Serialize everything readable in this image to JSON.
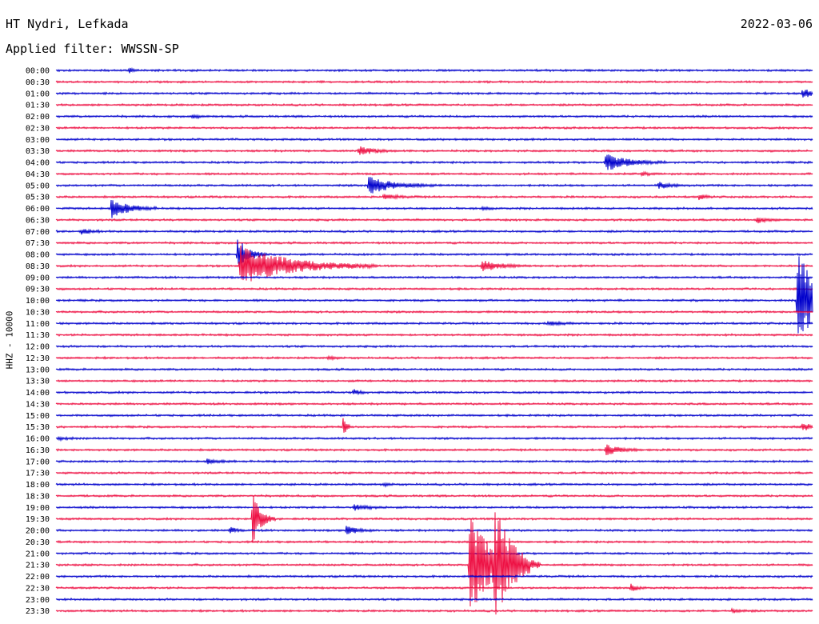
{
  "header": {
    "station": "HT Nydri, Lefkada",
    "date": "2022-03-06",
    "filter": "Applied filter: WWSSN-SP"
  },
  "chart_data": {
    "type": "line",
    "title": "HT Nydri, Lefkada",
    "subtitle": "Applied filter: WWSSN-SP",
    "ylabel": "HHZ - 10000",
    "rows": [
      "00:00",
      "00:30",
      "01:00",
      "01:30",
      "02:00",
      "02:30",
      "03:00",
      "03:30",
      "04:00",
      "04:30",
      "05:00",
      "05:30",
      "06:00",
      "06:30",
      "07:00",
      "07:30",
      "08:00",
      "08:30",
      "09:00",
      "09:30",
      "10:00",
      "10:30",
      "11:00",
      "11:30",
      "12:00",
      "12:30",
      "13:00",
      "13:30",
      "14:00",
      "14:30",
      "15:00",
      "15:30",
      "16:00",
      "16:30",
      "17:00",
      "17:30",
      "18:00",
      "18:30",
      "19:00",
      "19:30",
      "20:00",
      "20:30",
      "21:00",
      "21:30",
      "22:00",
      "22:30",
      "23:00",
      "23:30"
    ],
    "row_colors": [
      "#0000cc",
      "#ee1144"
    ],
    "x_range_minutes": [
      0,
      30
    ],
    "events": [
      {
        "row": 0,
        "minute": 2.9,
        "amp": 0.3,
        "dur": 0.2
      },
      {
        "row": 2,
        "minute": 29.6,
        "amp": 0.4,
        "dur": 0.5
      },
      {
        "row": 4,
        "minute": 5.4,
        "amp": 0.2,
        "dur": 0.3
      },
      {
        "row": 7,
        "minute": 12.0,
        "amp": 0.5,
        "dur": 0.5
      },
      {
        "row": 8,
        "minute": 21.8,
        "amp": 0.9,
        "dur": 0.8
      },
      {
        "row": 9,
        "minute": 23.2,
        "amp": 0.15,
        "dur": 0.3
      },
      {
        "row": 10,
        "minute": 12.4,
        "amp": 0.9,
        "dur": 0.9
      },
      {
        "row": 10,
        "minute": 23.9,
        "amp": 0.35,
        "dur": 0.4
      },
      {
        "row": 11,
        "minute": 13.0,
        "amp": 0.25,
        "dur": 0.5
      },
      {
        "row": 11,
        "minute": 25.5,
        "amp": 0.3,
        "dur": 0.2
      },
      {
        "row": 12,
        "minute": 2.2,
        "amp": 1.1,
        "dur": 0.6
      },
      {
        "row": 12,
        "minute": 16.9,
        "amp": 0.15,
        "dur": 0.2
      },
      {
        "row": 13,
        "minute": 27.8,
        "amp": 0.35,
        "dur": 0.3
      },
      {
        "row": 14,
        "minute": 1.0,
        "amp": 0.3,
        "dur": 0.3
      },
      {
        "row": 16,
        "minute": 7.2,
        "amp": 1.8,
        "dur": 0.4
      },
      {
        "row": 17,
        "minute": 7.3,
        "amp": 2.1,
        "dur": 1.8
      },
      {
        "row": 17,
        "minute": 16.9,
        "amp": 0.6,
        "dur": 0.6
      },
      {
        "row": 20,
        "minute": 29.4,
        "amp": 6.0,
        "dur": 0.7
      },
      {
        "row": 22,
        "minute": 19.5,
        "amp": 0.2,
        "dur": 0.5
      },
      {
        "row": 25,
        "minute": 10.8,
        "amp": 0.2,
        "dur": 0.2
      },
      {
        "row": 28,
        "minute": 11.8,
        "amp": 0.3,
        "dur": 0.2
      },
      {
        "row": 31,
        "minute": 11.4,
        "amp": 1.2,
        "dur": 0.1
      },
      {
        "row": 31,
        "minute": 29.6,
        "amp": 0.4,
        "dur": 0.4
      },
      {
        "row": 32,
        "minute": 0.1,
        "amp": 0.2,
        "dur": 0.3
      },
      {
        "row": 33,
        "minute": 21.8,
        "amp": 0.6,
        "dur": 0.5
      },
      {
        "row": 34,
        "minute": 6.0,
        "amp": 0.25,
        "dur": 0.4
      },
      {
        "row": 36,
        "minute": 13.0,
        "amp": 0.15,
        "dur": 0.2
      },
      {
        "row": 38,
        "minute": 11.8,
        "amp": 0.3,
        "dur": 0.5
      },
      {
        "row": 39,
        "minute": 7.8,
        "amp": 2.8,
        "dur": 0.3
      },
      {
        "row": 40,
        "minute": 6.9,
        "amp": 0.35,
        "dur": 0.2
      },
      {
        "row": 40,
        "minute": 11.5,
        "amp": 0.5,
        "dur": 0.4
      },
      {
        "row": 43,
        "minute": 16.4,
        "amp": 5.5,
        "dur": 0.8
      },
      {
        "row": 43,
        "minute": 17.4,
        "amp": 5.2,
        "dur": 0.6
      },
      {
        "row": 45,
        "minute": 22.8,
        "amp": 0.4,
        "dur": 0.2
      },
      {
        "row": 47,
        "minute": 26.8,
        "amp": 0.2,
        "dur": 0.3
      }
    ]
  }
}
